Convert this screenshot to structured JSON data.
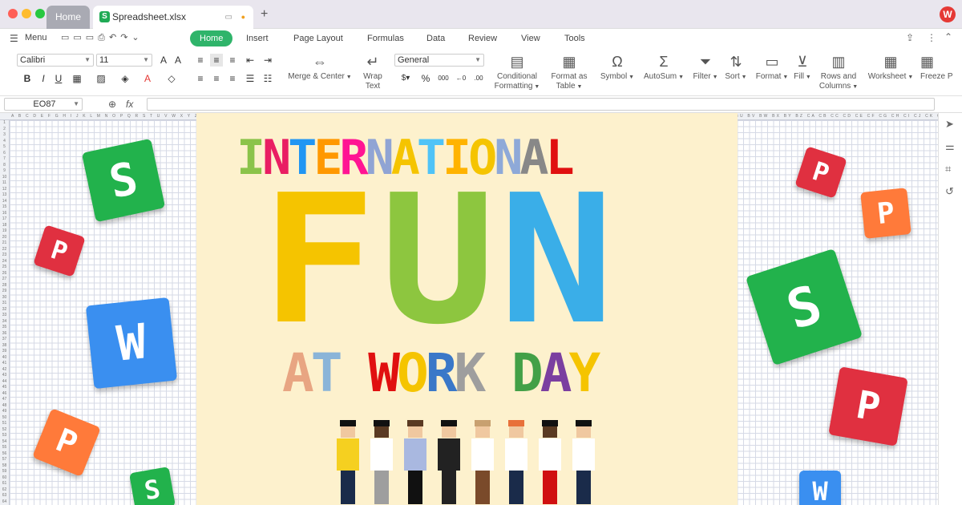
{
  "titlebar": {
    "tabs": [
      {
        "label": "Home"
      },
      {
        "label": "Spreadsheet.xlsx"
      }
    ],
    "new_tab_symbol": "+",
    "app_logo": "W"
  },
  "ribbon": {
    "menu_label": "Menu",
    "tabs": [
      "Home",
      "Insert",
      "Page Layout",
      "Formulas",
      "Data",
      "Review",
      "View",
      "Tools"
    ],
    "active_tab": "Home"
  },
  "toolbar": {
    "font_name": "Calibri",
    "font_size": "11",
    "number_format": "General",
    "buttons": {
      "merge": "Merge & Center",
      "wrap1": "Wrap",
      "wrap2": "Text",
      "cond1": "Conditional",
      "cond2": "Formatting",
      "fmt1": "Format as",
      "fmt2": "Table",
      "symbol": "Symbol",
      "autosum": "AutoSum",
      "filter": "Filter",
      "sort": "Sort",
      "format": "Format",
      "fill": "Fill",
      "rows1": "Rows and",
      "rows2": "Columns",
      "worksheet": "Worksheet",
      "freeze": "Freeze P"
    }
  },
  "formula_bar": {
    "name_box": "EO87",
    "fx": "fx",
    "formula": ""
  },
  "sheet": {
    "column_headers": "A B C D E F G H I J K L M N O P Q R S T U V W X Y Z AA AB AC AD AE AF AG AH AI AJ AK AL AM AN AO AP AQ AR AS AT AU AV AW AX AY AZ BA BB BC BD BE BF BG BH BI BJ BK BL BM BN BO BP BQ BR BS BT BU BV BW BX BY BZ CA CB CC CD CE CF CG CH CI CJ CK CL CM CN CO CP CQ CR CS CT CU CV CW CX CY CZ DA DB DC DD DE DF DG DH DI DJ DK DL DM DN DO DP DQ DR DS DT DU DV DW DX DY DZ EA EB EC ED EE EF EG EH EI EJ EK EL EM",
    "row_count": 64
  },
  "poster": {
    "line1": [
      {
        "ch": "I",
        "color": "#8bc34a"
      },
      {
        "ch": "N",
        "color": "#e91e63"
      },
      {
        "ch": "T",
        "color": "#2196f3"
      },
      {
        "ch": "E",
        "color": "#ff9800"
      },
      {
        "ch": "R",
        "color": "#ff1493"
      },
      {
        "ch": "N",
        "color": "#90a4d4"
      },
      {
        "ch": "A",
        "color": "#f5c400"
      },
      {
        "ch": "T",
        "color": "#4fc3f7"
      },
      {
        "ch": "I",
        "color": "#ffb300"
      },
      {
        "ch": "O",
        "color": "#f5c400"
      },
      {
        "ch": "N",
        "color": "#8ea9d8"
      },
      {
        "ch": "A",
        "color": "#888888"
      },
      {
        "ch": "L",
        "color": "#e01010"
      }
    ],
    "line2": [
      {
        "ch": "F",
        "color": "#f5c400"
      },
      {
        "ch": "U",
        "color": "#8dc63f"
      },
      {
        "ch": "N",
        "color": "#3aaee8"
      }
    ],
    "line3": [
      {
        "ch": "A",
        "color": "#e8a582"
      },
      {
        "ch": "T",
        "color": "#8ab4d8"
      },
      {
        "ch": " ",
        "color": "#000000"
      },
      {
        "ch": "W",
        "color": "#e01010"
      },
      {
        "ch": "O",
        "color": "#f5c400"
      },
      {
        "ch": "R",
        "color": "#3a78c8"
      },
      {
        "ch": "K",
        "color": "#9e9e9e"
      },
      {
        "ch": " ",
        "color": "#000000"
      },
      {
        "ch": "D",
        "color": "#43a047"
      },
      {
        "ch": "A",
        "color": "#7b3fa0"
      },
      {
        "ch": "Y",
        "color": "#f5c400"
      }
    ],
    "people": [
      {
        "hair": "#111111",
        "skin": "#f0c8a0",
        "top": "#f5d020",
        "bottom": "#1a2b4a"
      },
      {
        "hair": "#111111",
        "skin": "#5a3a22",
        "top": "#ffffff",
        "bottom": "#9e9e9e"
      },
      {
        "hair": "#5a3a22",
        "skin": "#f0c8a0",
        "top": "#a9b8e0",
        "bottom": "#111111"
      },
      {
        "hair": "#111111",
        "skin": "#f0c8a0",
        "top": "#222222",
        "bottom": "#222222"
      },
      {
        "hair": "#c8a070",
        "skin": "#f0c8a0",
        "top": "#ffffff",
        "bottom": "#7a4a2a"
      },
      {
        "hair": "#e8703a",
        "skin": "#f0c8a0",
        "top": "#ffffff",
        "bottom": "#1a2b4a"
      },
      {
        "hair": "#111111",
        "skin": "#5a3a22",
        "top": "#ffffff",
        "bottom": "#d01010"
      },
      {
        "hair": "#111111",
        "skin": "#f0c8a0",
        "top": "#ffffff",
        "bottom": "#1a2b4a"
      }
    ]
  },
  "tiles": [
    {
      "letter": "S",
      "color": "#22b24c"
    },
    {
      "letter": "P",
      "color": "#e03040"
    },
    {
      "letter": "W",
      "color": "#3a8ff0"
    },
    {
      "letter": "P",
      "color": "#ff7a3a"
    },
    {
      "letter": "S",
      "color": "#22b24c"
    },
    {
      "letter": "P",
      "color": "#e03040"
    },
    {
      "letter": "P",
      "color": "#ff7a3a"
    },
    {
      "letter": "S",
      "color": "#22b24c"
    },
    {
      "letter": "P",
      "color": "#e03040"
    },
    {
      "letter": "W",
      "color": "#3a8ff0"
    }
  ]
}
